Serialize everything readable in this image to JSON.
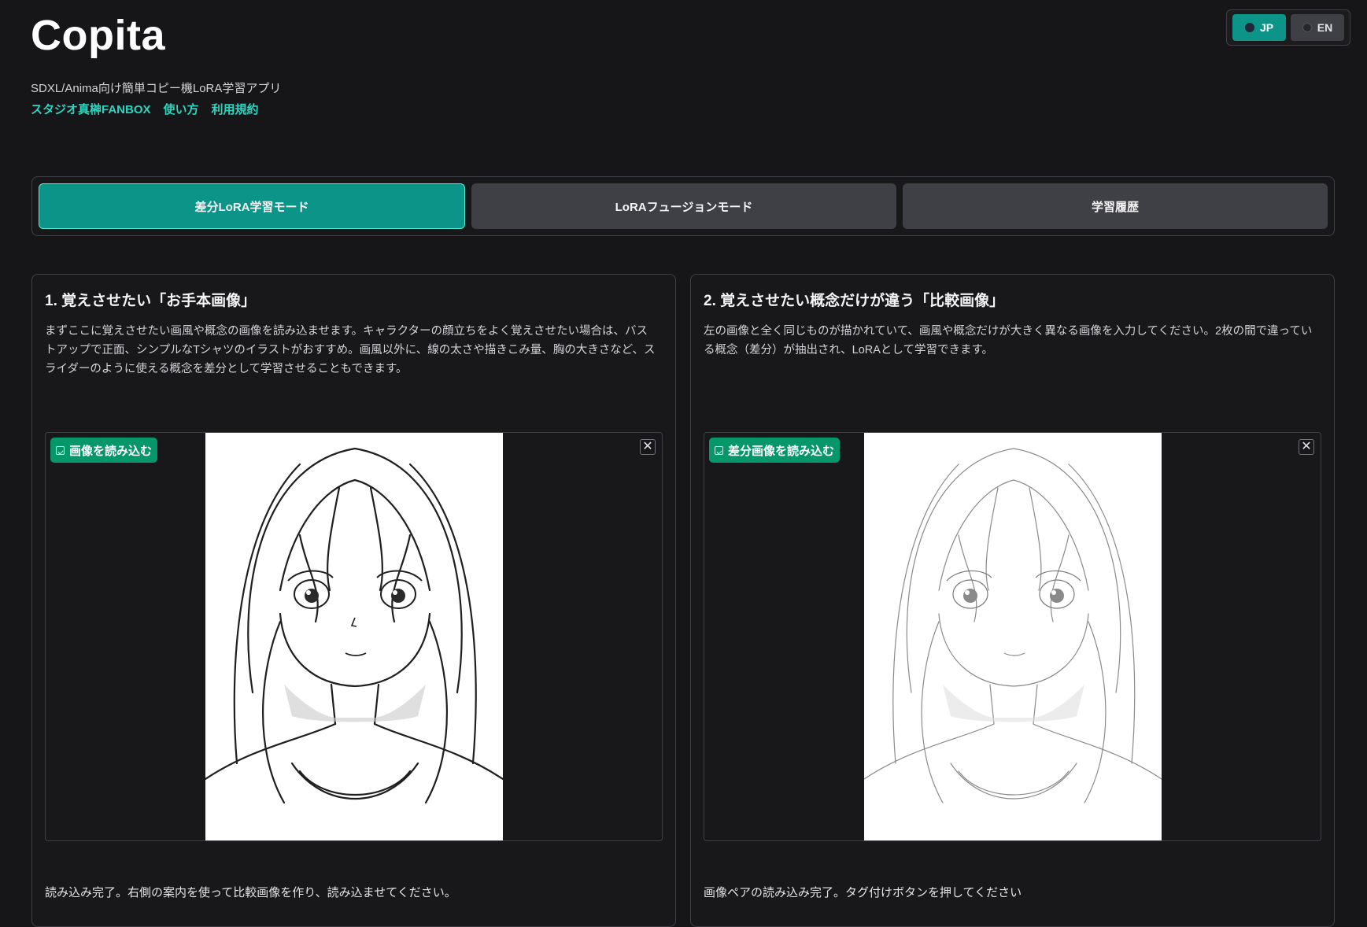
{
  "header": {
    "title": "Copita",
    "subtitle": "SDXL/Anima向け簡単コピー機LoRA学習アプリ",
    "links": [
      "スタジオ真榊FANBOX",
      "使い方",
      "利用規約"
    ]
  },
  "language": {
    "options": [
      {
        "label": "JP",
        "selected": true
      },
      {
        "label": "EN",
        "selected": false
      }
    ]
  },
  "modes": {
    "tabs": [
      {
        "label": "差分LoRA学習モード",
        "active": true
      },
      {
        "label": "LoRAフュージョンモード",
        "active": false
      },
      {
        "label": "学習履歴",
        "active": false
      }
    ]
  },
  "panels": [
    {
      "title": "1. 覚えさせたい「お手本画像」",
      "description": "まずここに覚えさせたい画風や概念の画像を読み込ませます。キャラクターの顔立ちをよく覚えさせたい場合は、バストアップで正面、シンプルなTシャツのイラストがおすすめ。画風以外に、線の太さや描きこみ量、胸の大きさなど、スライダーのように使える概念を差分として学習させることもできます。",
      "load_button": "画像を読み込む",
      "close_symbol": "✕",
      "status": "読み込み完了。右側の案内を使って比較画像を作り、読み込ませてください。"
    },
    {
      "title": "2. 覚えさせたい概念だけが違う「比較画像」",
      "description": "左の画像と全く同じものが描かれていて、画風や概念だけが大きく異なる画像を入力してください。2枚の間で違っている概念（差分）が抽出され、LoRAとして学習できます。",
      "load_button": "差分画像を読み込む",
      "close_symbol": "✕",
      "status": "画像ペアの読み込み完了。タグ付けボタンを押してください"
    }
  ],
  "colors": {
    "background": "#161618",
    "accent": "#0d9488",
    "badge": "#059669",
    "link": "#2dd4bf"
  }
}
